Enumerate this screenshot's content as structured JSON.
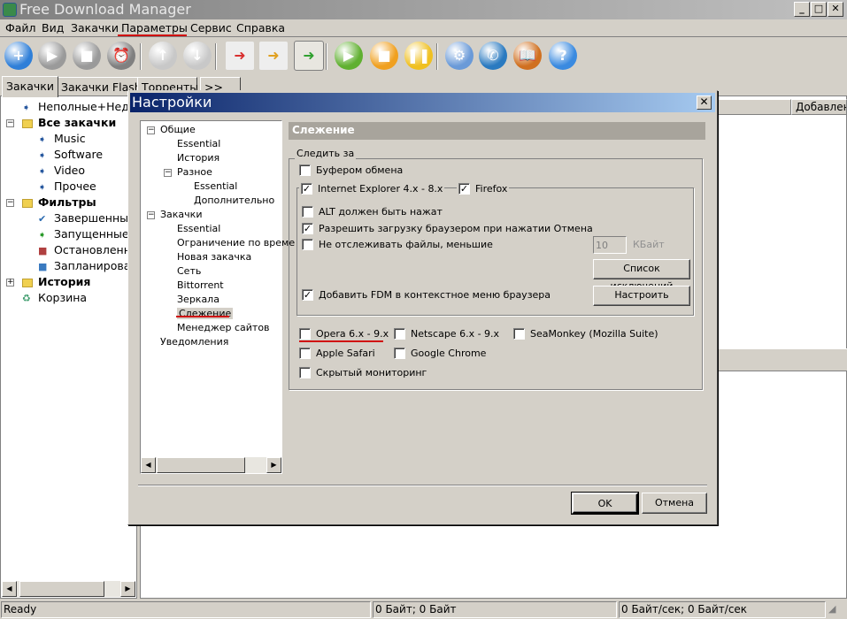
{
  "app": {
    "title": "Free Download Manager"
  },
  "menu": [
    "Файл",
    "Вид",
    "Закачки",
    "Параметры",
    "Сервис",
    "Справка"
  ],
  "toolbar": [
    {
      "name": "add-download",
      "glyph": "+",
      "color": "#2f7fd8"
    },
    {
      "name": "start",
      "glyph": "▶",
      "color": "#9a9a9a"
    },
    {
      "name": "stop",
      "glyph": "■",
      "color": "#9a9a9a"
    },
    {
      "name": "scheduler",
      "glyph": "⏰",
      "color": "#808080"
    },
    {
      "name": "move-up",
      "glyph": "↑",
      "color": "#c8c8c8"
    },
    {
      "name": "move-down",
      "glyph": "↓",
      "color": "#c8c8c8"
    },
    {
      "name": "traffic-low",
      "glyph": "➜",
      "color": "#d83030"
    },
    {
      "name": "traffic-medium",
      "glyph": "➜",
      "color": "#e0a020"
    },
    {
      "name": "traffic-high",
      "glyph": "➜",
      "color": "#30a030"
    },
    {
      "name": "start-all",
      "glyph": "▶",
      "color": "#60b030"
    },
    {
      "name": "stop-all",
      "glyph": "■",
      "color": "#f0a020"
    },
    {
      "name": "pause-all",
      "glyph": "❚❚",
      "color": "#f0c020"
    },
    {
      "name": "settings",
      "glyph": "⚙",
      "color": "#6a9ad8"
    },
    {
      "name": "dialup",
      "glyph": "✆",
      "color": "#2a7ac0"
    },
    {
      "name": "bookmarks",
      "glyph": "📖",
      "color": "#d07020"
    },
    {
      "name": "help",
      "glyph": "?",
      "color": "#3a8ae0"
    }
  ],
  "tabs": [
    "Закачки",
    "Закачки Flash",
    "Торренты",
    ">>"
  ],
  "left_tree": [
    {
      "label": "Неполные+Недав",
      "level": 1,
      "icon": "arrow",
      "color": "#2a5aa0"
    },
    {
      "label": "Все закачки",
      "level": 0,
      "icon": "folder",
      "bold": true,
      "expander": "−"
    },
    {
      "label": "Music",
      "level": 2,
      "icon": "arrow",
      "color": "#2a5aa0"
    },
    {
      "label": "Software",
      "level": 2,
      "icon": "arrow",
      "color": "#2a5aa0"
    },
    {
      "label": "Video",
      "level": 2,
      "icon": "arrow",
      "color": "#2a5aa0"
    },
    {
      "label": "Прочее",
      "level": 2,
      "icon": "arrow",
      "color": "#2a5aa0"
    },
    {
      "label": "Фильтры",
      "level": 0,
      "icon": "folder",
      "bold": true,
      "expander": "−"
    },
    {
      "label": "Завершенные",
      "level": 2,
      "icon": "check",
      "color": "#2a6ab0"
    },
    {
      "label": "Запущенные",
      "level": 2,
      "icon": "arrow",
      "color": "#2a9a2a"
    },
    {
      "label": "Остановленны",
      "level": 2,
      "icon": "square",
      "color": "#b04040"
    },
    {
      "label": "Запланирован",
      "level": 2,
      "icon": "square",
      "color": "#3a7ac0"
    },
    {
      "label": "История",
      "level": 0,
      "icon": "folder",
      "bold": true,
      "expander": "+"
    },
    {
      "label": "Корзина",
      "level": 1,
      "icon": "bin",
      "color": "#3a9a6a"
    }
  ],
  "list_header": {
    "added": "Добавлен"
  },
  "status": {
    "ready": "Ready",
    "size": "0 Байт; 0 Байт",
    "speed": "0 Байт/сек; 0 Байт/сек"
  },
  "dialog": {
    "title": "Настройки",
    "tree": [
      {
        "label": "Общие",
        "level": 0,
        "expander": "−"
      },
      {
        "label": "Essential",
        "level": 1
      },
      {
        "label": "История",
        "level": 1
      },
      {
        "label": "Разное",
        "level": 1,
        "expander": "−"
      },
      {
        "label": "Essential",
        "level": 2
      },
      {
        "label": "Дополнительно",
        "level": 2
      },
      {
        "label": "Закачки",
        "level": 0,
        "expander": "−"
      },
      {
        "label": "Essential",
        "level": 1
      },
      {
        "label": "Ограничение по време",
        "level": 1
      },
      {
        "label": "Новая закачка",
        "level": 1
      },
      {
        "label": "Сеть",
        "level": 1
      },
      {
        "label": "Bittorrent",
        "level": 1
      },
      {
        "label": "Зеркала",
        "level": 1
      },
      {
        "label": "Слежение",
        "level": 1,
        "selected": true
      },
      {
        "label": "Менеджер сайтов",
        "level": 1
      },
      {
        "label": "Уведомления",
        "level": 0
      }
    ],
    "section_title": "Слежение",
    "group_label": "Следить за",
    "clipboard": {
      "label": "Буфером обмена",
      "checked": false
    },
    "ie": {
      "label": "Internet Explorer 4.x - 8.x",
      "checked": true
    },
    "firefox": {
      "label": "Firefox",
      "checked": true
    },
    "alt": {
      "label": "ALT должен быть нажат",
      "checked": false
    },
    "allow_cancel": {
      "label": "Разрешить загрузку браузером при нажатии Отмена",
      "checked": true
    },
    "skip_small": {
      "label": "Не отслеживать файлы, меньшие",
      "checked": false
    },
    "min_size": "10",
    "size_unit": "КБайт",
    "exceptions_button": "Список исключений",
    "context_menu": {
      "label": "Добавить FDM в контекстное меню браузера",
      "checked": true
    },
    "configure_button": "Настроить",
    "opera": {
      "label": "Opera 6.x - 9.x",
      "checked": false
    },
    "netscape": {
      "label": "Netscape 6.x - 9.x",
      "checked": false
    },
    "seamonkey": {
      "label": "SeaMonkey (Mozilla Suite)",
      "checked": false
    },
    "safari": {
      "label": "Apple Safari",
      "checked": false
    },
    "chrome": {
      "label": "Google Chrome",
      "checked": false
    },
    "hidden": {
      "label": "Скрытый мониторинг",
      "checked": false
    },
    "ok": "OK",
    "cancel": "Отмена"
  }
}
